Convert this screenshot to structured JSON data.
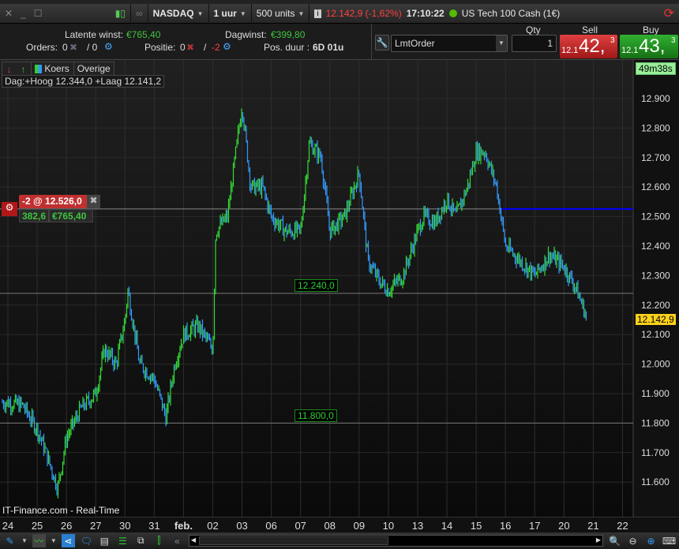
{
  "titlebar": {
    "exchange": "NASDAQ",
    "interval": "1 uur",
    "units": "500 units",
    "price": "12.142,9 (-1,62%)",
    "time": "17:10:22",
    "instrument": "US Tech 100 Cash (1€)"
  },
  "info": {
    "latent_label": "Latente winst:",
    "latent_value": "€765,40",
    "day_label": "Dagwinst:",
    "day_value": "€399,80",
    "orders_label": "Orders:",
    "orders_a": "0",
    "orders_b": "/ 0",
    "positie_label": "Positie:",
    "positie_a": "0",
    "positie_sep": "/",
    "positie_b": "-2",
    "duur_label": "Pos. duur :",
    "duur_value": "6D 01u"
  },
  "order": {
    "type": "LmtOrder",
    "qty_label": "Qty",
    "qty": "1",
    "sell_label": "Sell",
    "sell_prefix": "12.1",
    "sell_big": "42,",
    "sell_sup": "3",
    "buy_label": "Buy",
    "buy_prefix": "12.1",
    "buy_big": "43,",
    "buy_sup": "3"
  },
  "chart": {
    "tab_koers": "Koers",
    "tab_overige": "Overige",
    "daybox": "Dag:+Hoog 12.344,0 +Laag 12.141,2",
    "timer": "49m38s",
    "position_label": "-2 @ 12.526,0",
    "pos_points": "382,6",
    "pos_value": "€765,40",
    "level1": "12.240,0",
    "level2": "11.800,0",
    "current": "12.142,9",
    "watermark": "IT-Finance.com - Real-Time",
    "colors": {
      "up": "#33dd33",
      "down": "#3399ff",
      "position_line": "#0000ff"
    }
  },
  "chart_data": {
    "type": "line",
    "yticks": [
      "12.900",
      "12.800",
      "12.700",
      "12.600",
      "12.500",
      "12.400",
      "12.300",
      "12.200",
      "12.100",
      "12.000",
      "11.900",
      "11.800",
      "11.700",
      "11.600"
    ],
    "ylim": [
      11540,
      12960
    ],
    "xticks": [
      "24",
      "25",
      "26",
      "27",
      "30",
      "31",
      "feb.",
      "02",
      "03",
      "06",
      "07",
      "08",
      "09",
      "10",
      "13",
      "14",
      "15",
      "16",
      "17",
      "20",
      "21",
      "22"
    ],
    "price_path": [
      [
        0,
        11870
      ],
      [
        0.5,
        11860
      ],
      [
        1,
        11780
      ],
      [
        1.3,
        11700
      ],
      [
        1.7,
        11580
      ],
      [
        2,
        11750
      ],
      [
        2.5,
        11850
      ],
      [
        3,
        11900
      ],
      [
        3.3,
        12050
      ],
      [
        3.7,
        12000
      ],
      [
        4,
        12150
      ],
      [
        4.1,
        12250
      ],
      [
        4.5,
        12000
      ],
      [
        5,
        11950
      ],
      [
        5.4,
        11820
      ],
      [
        5.7,
        12000
      ],
      [
        6,
        12100
      ],
      [
        6.5,
        12130
      ],
      [
        7,
        12050
      ],
      [
        7.1,
        12450
      ],
      [
        7.5,
        12500
      ],
      [
        8,
        12880
      ],
      [
        8.3,
        12600
      ],
      [
        8.7,
        12600
      ],
      [
        9,
        12500
      ],
      [
        9.5,
        12450
      ],
      [
        10,
        12450
      ],
      [
        10.3,
        12750
      ],
      [
        10.7,
        12700
      ],
      [
        11,
        12450
      ],
      [
        11.5,
        12500
      ],
      [
        12,
        12650
      ],
      [
        12.3,
        12350
      ],
      [
        12.7,
        12280
      ],
      [
        13,
        12250
      ],
      [
        13.5,
        12300
      ],
      [
        14,
        12450
      ],
      [
        14.2,
        12500
      ],
      [
        14.6,
        12480
      ],
      [
        15,
        12560
      ],
      [
        15.3,
        12500
      ],
      [
        15.7,
        12600
      ],
      [
        16,
        12720
      ],
      [
        16.3,
        12720
      ],
      [
        16.7,
        12600
      ],
      [
        17,
        12400
      ],
      [
        17.5,
        12350
      ],
      [
        18,
        12300
      ],
      [
        18.5,
        12370
      ],
      [
        19,
        12330
      ],
      [
        19.4,
        12260
      ],
      [
        19.7,
        12180
      ],
      [
        19.8,
        12143
      ]
    ]
  }
}
